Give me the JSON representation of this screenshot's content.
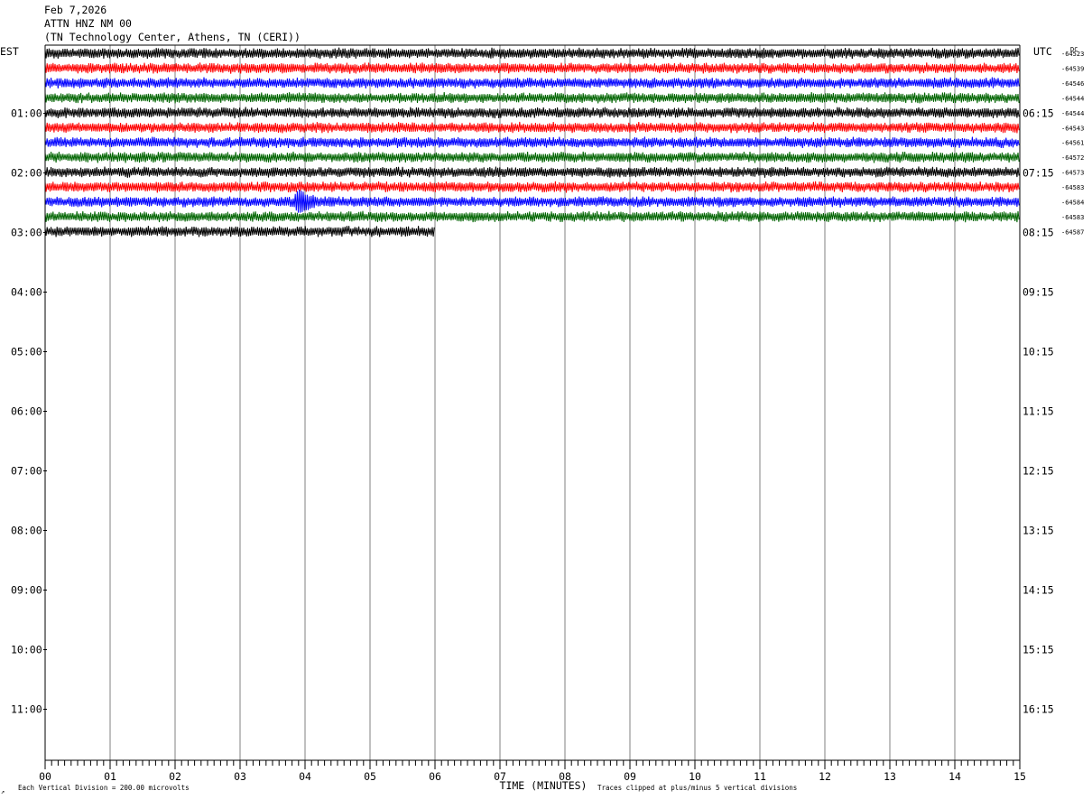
{
  "header": {
    "date": "Feb 7,2026",
    "station": "ATTN HNZ NM 00",
    "location": "(TN Technology Center, Athens, TN (CERI))"
  },
  "chart_data": {
    "type": "line",
    "left_axis_title": "EST",
    "right_axis_title": "UTC",
    "dc_label": "DC",
    "x_axis_title": "TIME (MINUTES)",
    "x_ticks": [
      "00",
      "01",
      "02",
      "03",
      "04",
      "05",
      "06",
      "07",
      "08",
      "09",
      "10",
      "11",
      "12",
      "13",
      "14",
      "15"
    ],
    "xlim": [
      0,
      15
    ],
    "left_hour_labels": [
      "01:00",
      "02:00",
      "03:00",
      "04:00",
      "05:00",
      "06:00",
      "07:00",
      "08:00",
      "09:00",
      "10:00",
      "11:00"
    ],
    "right_hour_labels": [
      "06:15",
      "07:15",
      "08:15",
      "09:15",
      "10:15",
      "11:15",
      "12:15",
      "13:15",
      "14:15",
      "15:15",
      "16:15"
    ],
    "dc_offsets": [
      "-64523",
      "-64539",
      "-64546",
      "-64544",
      "-64544",
      "-64543",
      "-64561",
      "-64572",
      "-64573",
      "-64583",
      "-64584",
      "-64583",
      "-64587"
    ],
    "trace_colors": [
      "#000000",
      "#ff0000",
      "#0000ff",
      "#006400"
    ],
    "trace_minutes_per_line": 15,
    "last_trace_end_minute": 6.0,
    "event": {
      "trace_index": 10,
      "minute": 3.9
    },
    "footnote_left": "Each Vertical Division =  200.00 microvolts",
    "footnote_right": "Traces clipped at plus/minus 5 vertical divisions",
    "corner_mark": "↗"
  }
}
